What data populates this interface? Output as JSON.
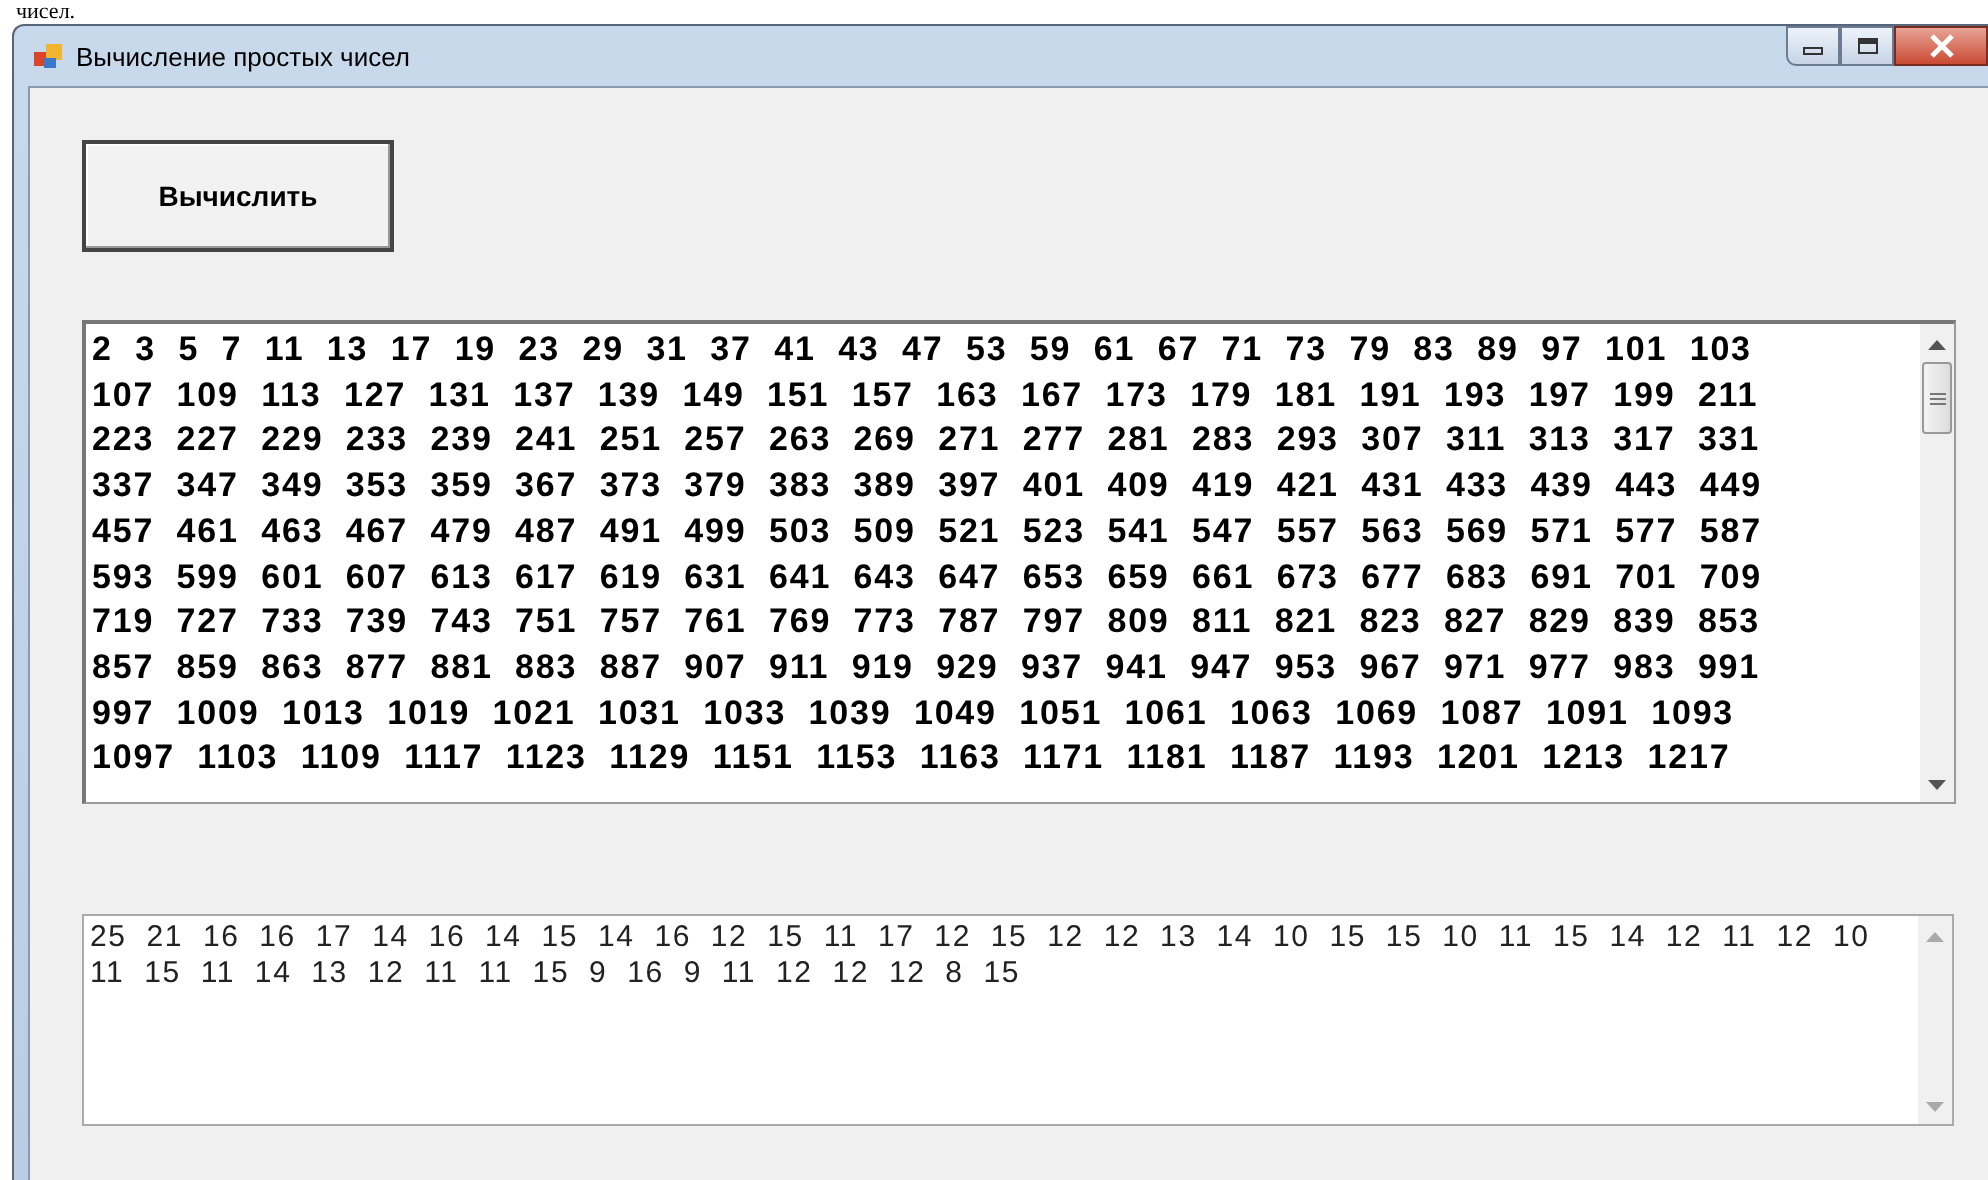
{
  "document_text": "чисел.",
  "window": {
    "title": "Вычисление простых чисел"
  },
  "compute_button": "Вычислить",
  "primes_box": {
    "lines": [
      "2  3  5  7  11  13  17  19  23  29  31  37  41  43  47  53  59  61  67  71  73  79  83  89  97  101  103",
      "107  109  113  127  131  137  139  149  151  157  163  167  173  179  181  191  193  197  199  211",
      "223  227  229  233  239  241  251  257  263  269  271  277  281  283  293  307  311  313  317  331",
      "337  347  349  353  359  367  373  379  383  389  397  401  409  419  421  431  433  439  443  449",
      "457  461  463  467  479  487  491  499  503  509  521  523  541  547  557  563  569  571  577  587",
      "593  599  601  607  613  617  619  631  641  643  647  653  659  661  673  677  683  691  701  709",
      "719  727  733  739  743  751  757  761  769  773  787  797  809  811  821  823  827  829  839  853",
      "857  859  863  877  881  883  887  907  911  919  929  937  941  947  953  967  971  977  983  991",
      "997  1009  1013  1019  1021  1031  1033  1039  1049  1051  1061  1063  1069  1087  1091  1093",
      "1097  1103  1109  1117  1123  1129  1151  1153  1163  1171  1181  1187  1193  1201  1213  1217"
    ]
  },
  "counts_box": {
    "lines": [
      "25  21  16  16  17  14  16  14  15  14  16  12  15  11  17  12  15  12  12  13  14  10  15  15  10  11  15  14  12  11  12  10",
      "11  15  11  14  13  12  11  11  15  9  16  9  11  12  12  12  8  15"
    ]
  }
}
